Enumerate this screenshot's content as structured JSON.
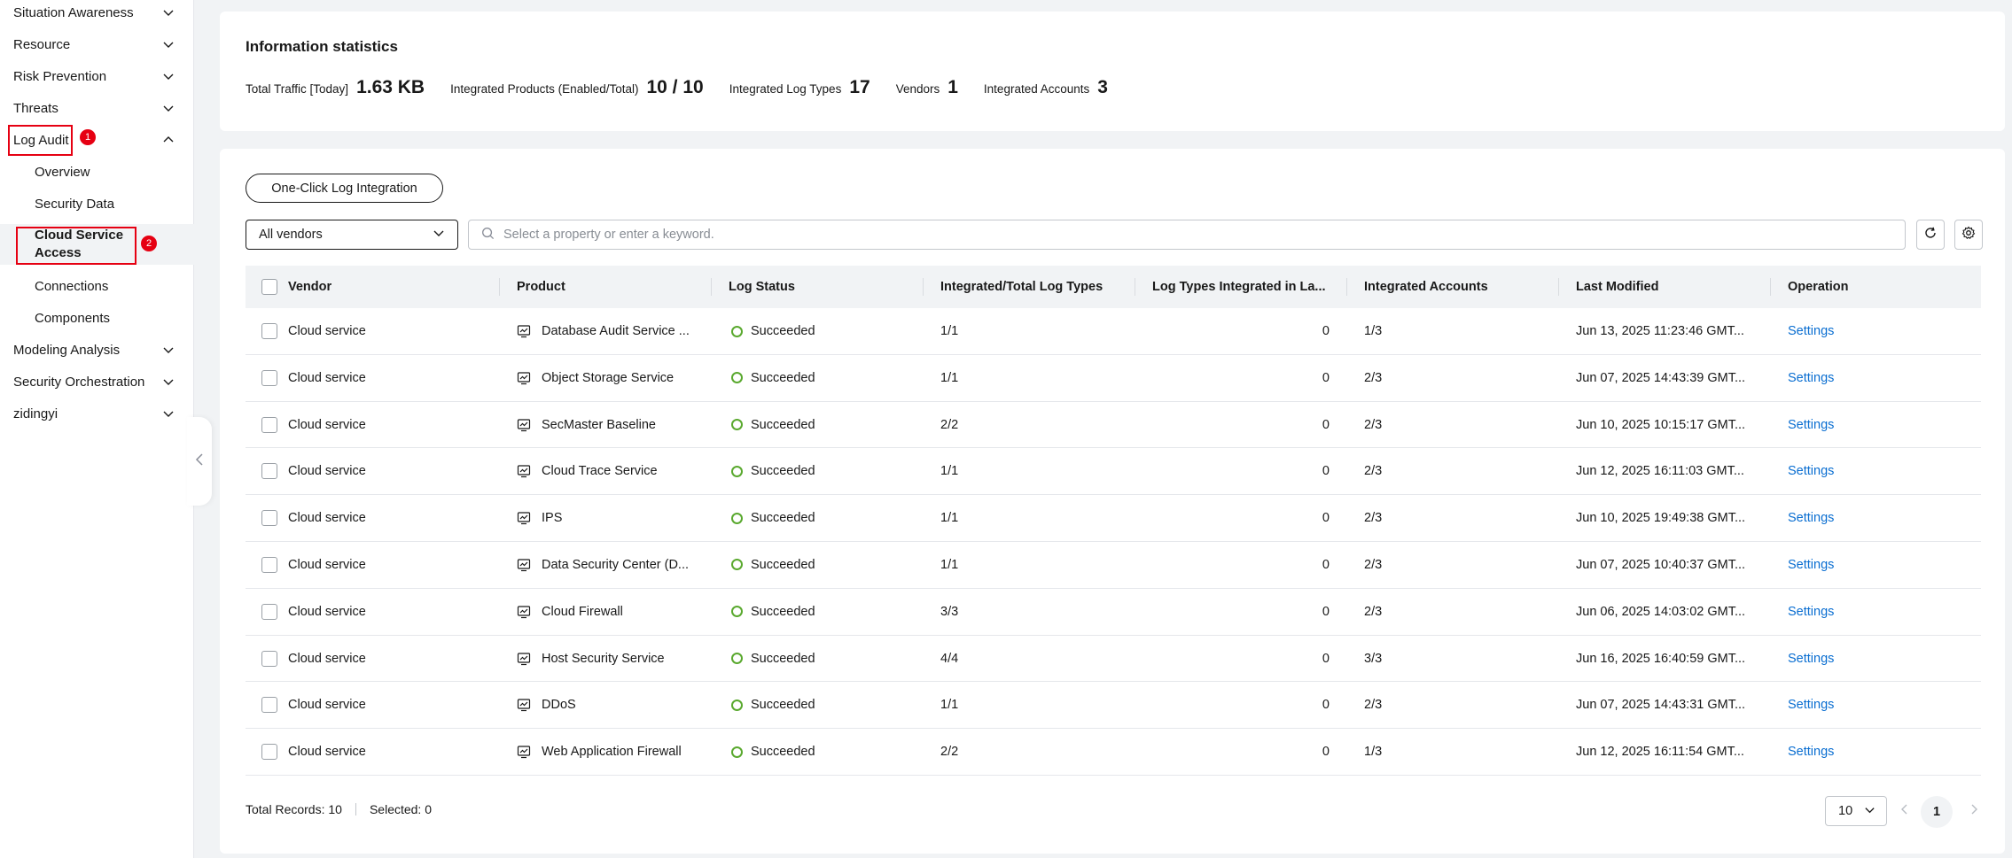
{
  "sidebar": {
    "items": [
      {
        "label": "Situation Awareness",
        "expanded": false
      },
      {
        "label": "Resource",
        "expanded": false
      },
      {
        "label": "Risk Prevention",
        "expanded": false
      },
      {
        "label": "Threats",
        "expanded": false
      },
      {
        "label": "Log Audit",
        "expanded": true
      },
      {
        "label": "Modeling Analysis",
        "expanded": false
      },
      {
        "label": "Security Orchestration",
        "expanded": false
      },
      {
        "label": "zidingyi",
        "expanded": false
      }
    ],
    "log_audit_children": [
      {
        "label": "Overview"
      },
      {
        "label": "Security Data"
      },
      {
        "label": "Cloud Service Access",
        "active": true
      },
      {
        "label": "Connections"
      },
      {
        "label": "Components"
      }
    ],
    "annotations": [
      "1",
      "2"
    ]
  },
  "stats": {
    "title": "Information statistics",
    "items": [
      {
        "label": "Total Traffic [Today]",
        "value": "1.63 KB"
      },
      {
        "label": "Integrated Products (Enabled/Total)",
        "value": "10 / 10"
      },
      {
        "label": "Integrated Log Types",
        "value": "17"
      },
      {
        "label": "Vendors",
        "value": "1"
      },
      {
        "label": "Integrated Accounts",
        "value": "3"
      }
    ]
  },
  "toolbar": {
    "integration_button": "One-Click Log Integration",
    "vendor_filter": "All vendors",
    "search_placeholder": "Select a property or enter a keyword."
  },
  "table": {
    "columns": [
      "Vendor",
      "Product",
      "Log Status",
      "Integrated/Total Log Types",
      "Log Types Integrated in La...",
      "Integrated Accounts",
      "Last Modified",
      "Operation"
    ],
    "rows": [
      {
        "vendor": "Cloud service",
        "product": "Database Audit Service ...",
        "status": "Succeeded",
        "log_types": "1/1",
        "recent": "0",
        "accounts": "1/3",
        "modified": "Jun 13, 2025 11:23:46 GMT...",
        "operation": "Settings"
      },
      {
        "vendor": "Cloud service",
        "product": "Object Storage Service",
        "status": "Succeeded",
        "log_types": "1/1",
        "recent": "0",
        "accounts": "2/3",
        "modified": "Jun 07, 2025 14:43:39 GMT...",
        "operation": "Settings"
      },
      {
        "vendor": "Cloud service",
        "product": "SecMaster Baseline",
        "status": "Succeeded",
        "log_types": "2/2",
        "recent": "0",
        "accounts": "2/3",
        "modified": "Jun 10, 2025 10:15:17 GMT...",
        "operation": "Settings"
      },
      {
        "vendor": "Cloud service",
        "product": "Cloud Trace Service",
        "status": "Succeeded",
        "log_types": "1/1",
        "recent": "0",
        "accounts": "2/3",
        "modified": "Jun 12, 2025 16:11:03 GMT...",
        "operation": "Settings"
      },
      {
        "vendor": "Cloud service",
        "product": "IPS",
        "status": "Succeeded",
        "log_types": "1/1",
        "recent": "0",
        "accounts": "2/3",
        "modified": "Jun 10, 2025 19:49:38 GMT...",
        "operation": "Settings"
      },
      {
        "vendor": "Cloud service",
        "product": "Data Security Center (D...",
        "status": "Succeeded",
        "log_types": "1/1",
        "recent": "0",
        "accounts": "2/3",
        "modified": "Jun 07, 2025 10:40:37 GMT...",
        "operation": "Settings"
      },
      {
        "vendor": "Cloud service",
        "product": "Cloud Firewall",
        "status": "Succeeded",
        "log_types": "3/3",
        "recent": "0",
        "accounts": "2/3",
        "modified": "Jun 06, 2025 14:03:02 GMT...",
        "operation": "Settings"
      },
      {
        "vendor": "Cloud service",
        "product": "Host Security Service",
        "status": "Succeeded",
        "log_types": "4/4",
        "recent": "0",
        "accounts": "3/3",
        "modified": "Jun 16, 2025 16:40:59 GMT...",
        "operation": "Settings"
      },
      {
        "vendor": "Cloud service",
        "product": "DDoS",
        "status": "Succeeded",
        "log_types": "1/1",
        "recent": "0",
        "accounts": "2/3",
        "modified": "Jun 07, 2025 14:43:31 GMT...",
        "operation": "Settings"
      },
      {
        "vendor": "Cloud service",
        "product": "Web Application Firewall",
        "status": "Succeeded",
        "log_types": "2/2",
        "recent": "0",
        "accounts": "1/3",
        "modified": "Jun 12, 2025 16:11:54 GMT...",
        "operation": "Settings"
      }
    ]
  },
  "footer": {
    "total_records": "Total Records: 10",
    "selected": "Selected: 0",
    "page_size": "10",
    "current_page": "1"
  },
  "colors": {
    "accent_link": "#0a6ed1",
    "success": "#5aa92f",
    "annotation_red": "#e60012"
  }
}
